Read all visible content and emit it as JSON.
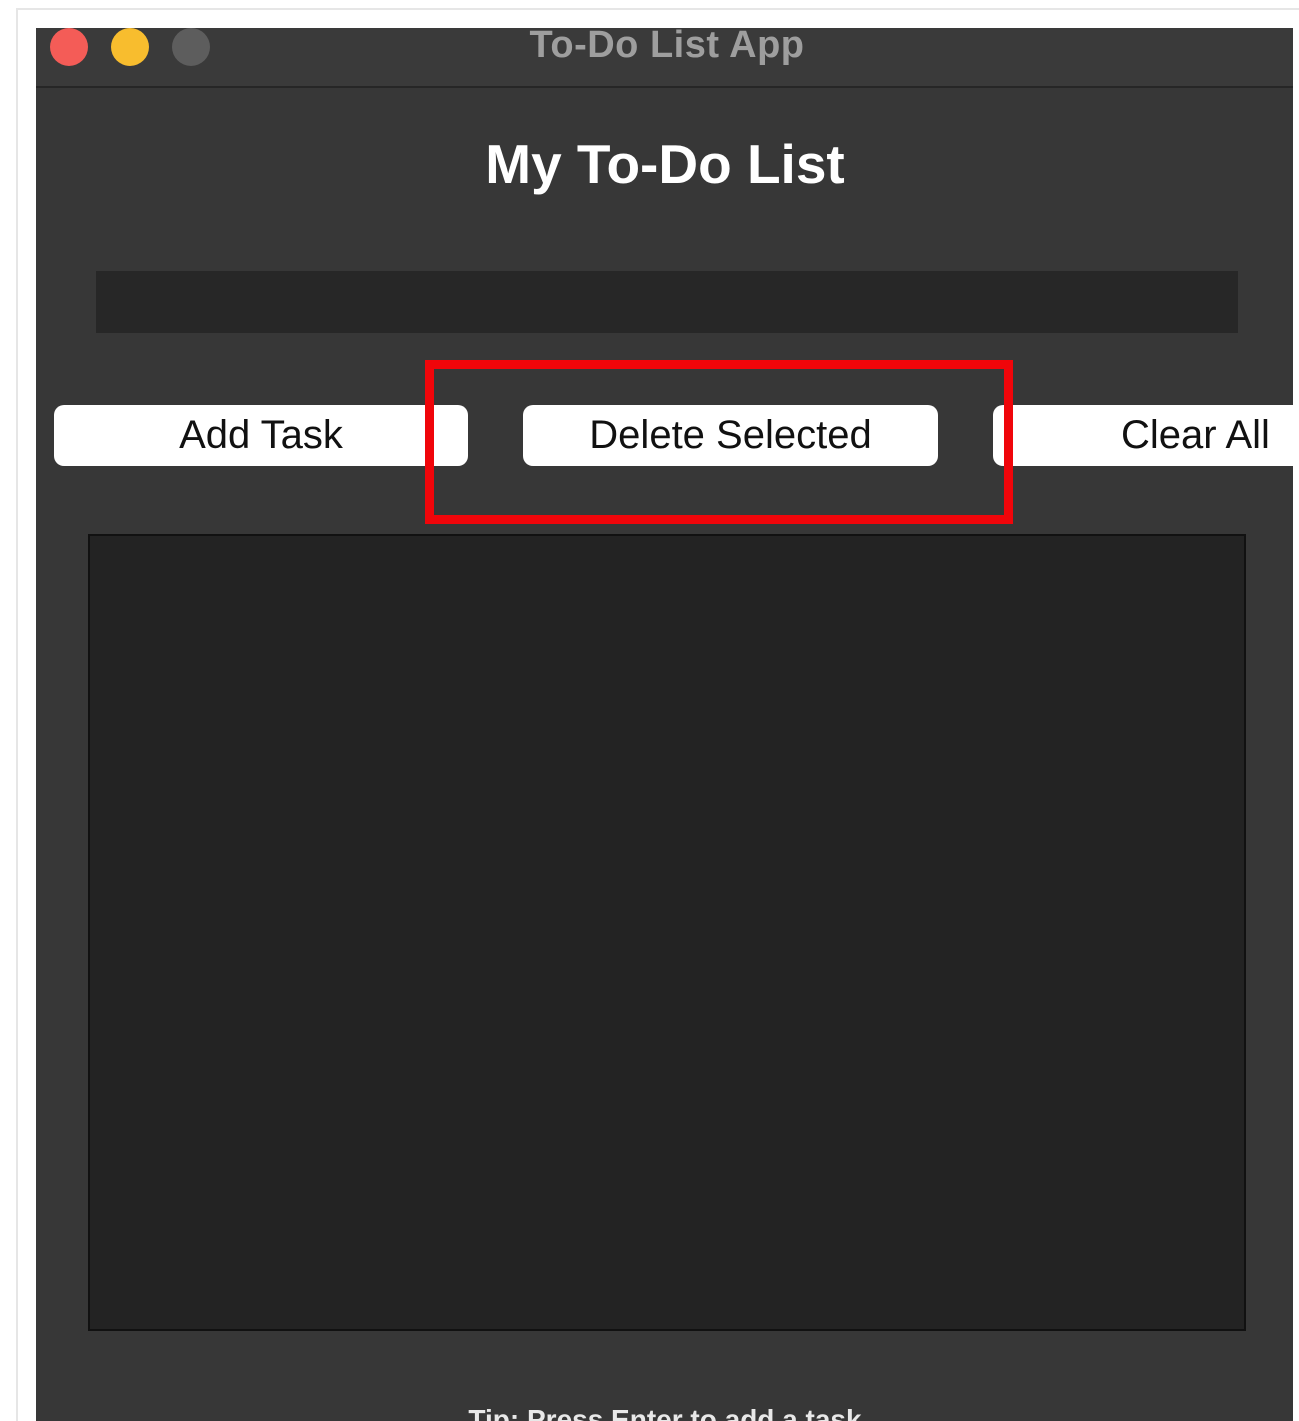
{
  "window": {
    "title": "To-Do List App"
  },
  "main": {
    "heading": "My To-Do List",
    "task_input": {
      "value": "",
      "placeholder": ""
    },
    "buttons": {
      "add_label": "Add Task",
      "delete_label": "Delete Selected",
      "clear_label": "Clear All"
    },
    "tasks": [],
    "tip": "Tip: Press Enter to add a task"
  },
  "colors": {
    "window_background": "#373737",
    "list_background": "#232323",
    "highlight": "#f0050a",
    "close_button": "#f45c57",
    "minimize_button": "#f8bd2e",
    "zoom_button": "#5d5d5d"
  },
  "icons": {
    "close": "close-icon",
    "minimize": "minimize-icon",
    "zoom": "zoom-icon"
  }
}
